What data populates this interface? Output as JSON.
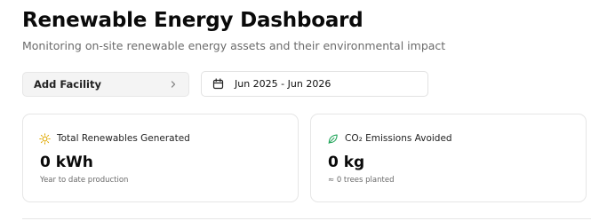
{
  "header": {
    "title": "Renewable Energy Dashboard",
    "subtitle": "Monitoring on-site renewable energy assets and their environmental impact"
  },
  "toolbar": {
    "add_facility_label": "Add Facility",
    "add_facility_icon": "chevron-right-icon",
    "date_range_label": "Jun 2025 - Jun 2026",
    "date_range_icon": "calendar-icon"
  },
  "cards": [
    {
      "icon": "sun-icon",
      "icon_color": "#e0a800",
      "title": "Total Renewables Generated",
      "value": "0 kWh",
      "note": "Year to date production"
    },
    {
      "icon": "leaf-icon",
      "icon_color": "#22a55a",
      "title": "CO₂ Emissions Avoided",
      "value": "0 kg",
      "note": "≈ 0 trees planted"
    }
  ]
}
